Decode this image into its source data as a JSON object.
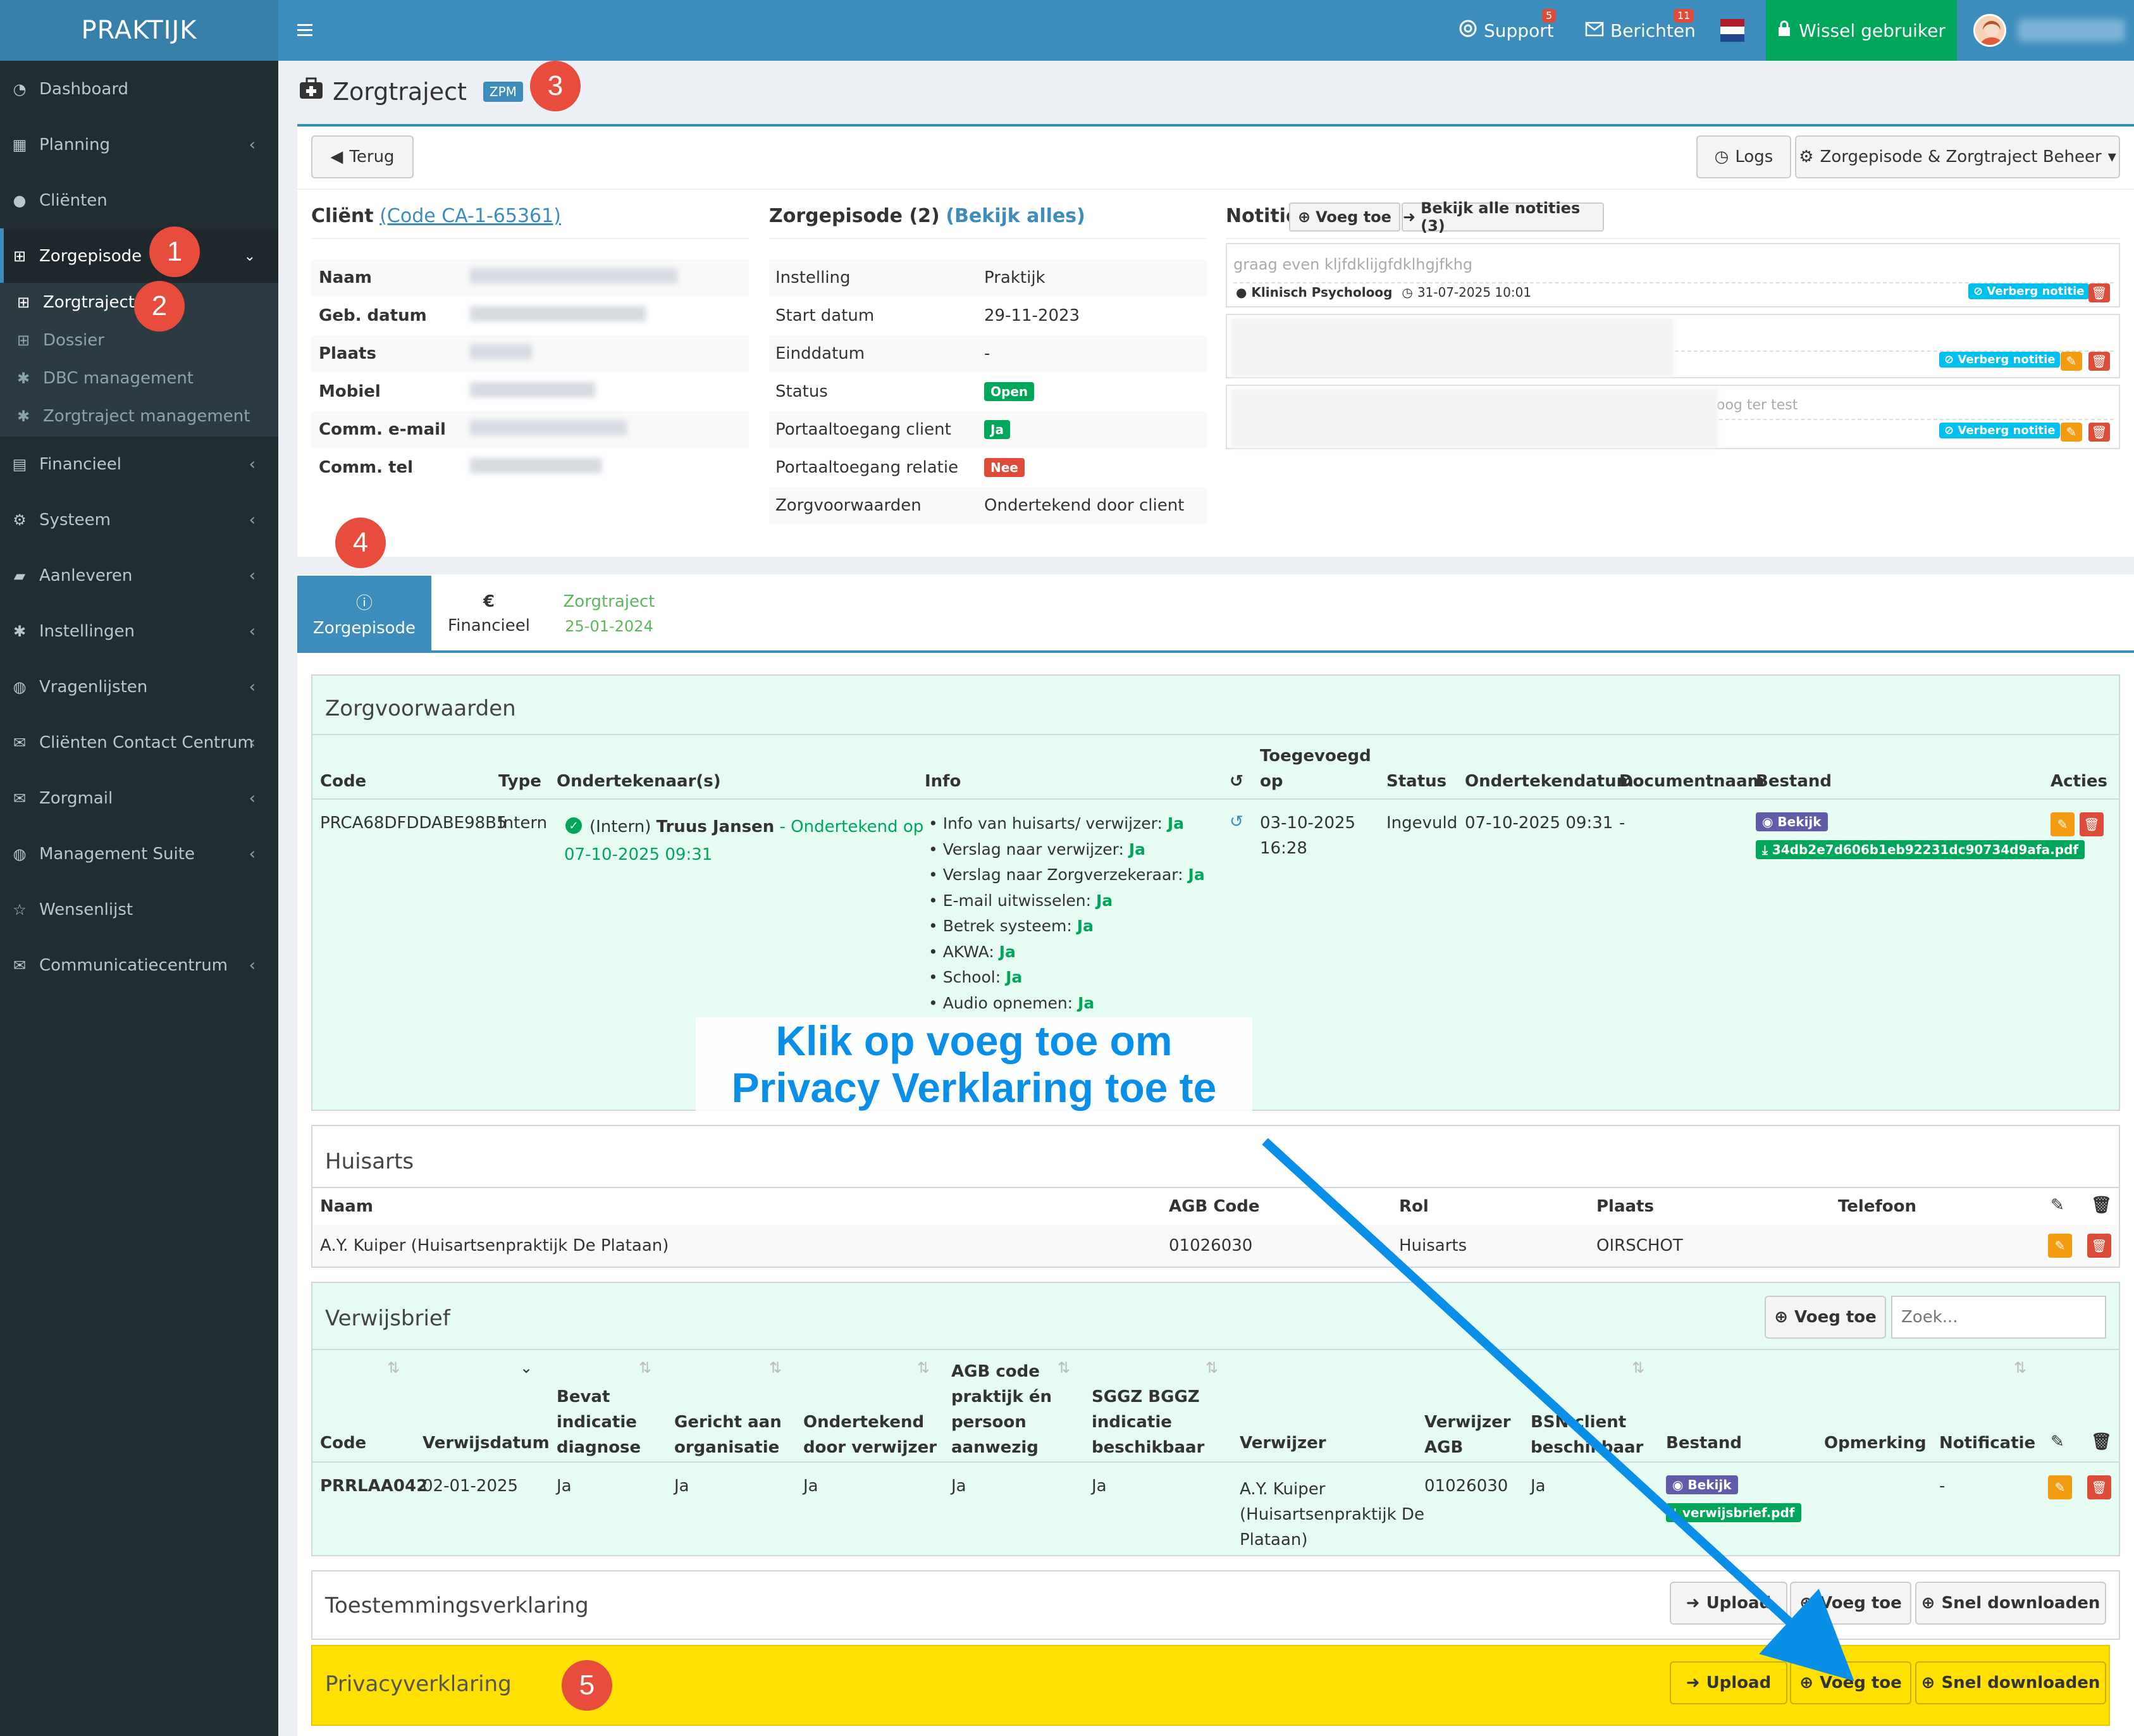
{
  "app": {
    "brand": "PRAKTIJK"
  },
  "topbar": {
    "support": "Support",
    "support_badge": "5",
    "messages": "Berichten",
    "messages_badge": "11",
    "switch_user": "Wissel gebruiker"
  },
  "sidebar": {
    "items": [
      {
        "label": "Dashboard",
        "icon": "dashboard-icon"
      },
      {
        "label": "Planning",
        "icon": "calendar-icon"
      },
      {
        "label": "Cliënten",
        "icon": "user-icon"
      },
      {
        "label": "Zorgepisode",
        "icon": "medkit-icon"
      },
      {
        "label": "Financieel",
        "icon": "book-icon"
      },
      {
        "label": "Systeem",
        "icon": "cogs-icon"
      },
      {
        "label": "Aanleveren",
        "icon": "truck-icon"
      },
      {
        "label": "Instellingen",
        "icon": "gear-icon"
      },
      {
        "label": "Vragenlijsten",
        "icon": "globe-icon"
      },
      {
        "label": "Cliënten Contact Centrum",
        "icon": "envelope-icon"
      },
      {
        "label": "Zorgmail",
        "icon": "envelope-icon"
      },
      {
        "label": "Management Suite",
        "icon": "globe-icon"
      },
      {
        "label": "Wensenlijst",
        "icon": "star-icon"
      },
      {
        "label": "Communicatiecentrum",
        "icon": "envelope-icon"
      }
    ],
    "subitems": [
      "Zorgtraject",
      "Dossier",
      "DBC management",
      "Zorgtraject management"
    ]
  },
  "markers": [
    "1",
    "2",
    "3",
    "4",
    "5"
  ],
  "page": {
    "title": "Zorgtraject",
    "badge": "ZPM"
  },
  "toolbar": {
    "back": "Terug",
    "logs": "Logs",
    "manage": "Zorgepisode & Zorgtraject Beheer"
  },
  "client": {
    "heading": "Cliënt",
    "code_link": "(Code CA-1-65361)",
    "rows": [
      "Naam",
      "Geb. datum",
      "Plaats",
      "Mobiel",
      "Comm. e-mail",
      "Comm. tel"
    ]
  },
  "episode": {
    "heading": "Zorgepisode (2)",
    "link": "(Bekijk alles)",
    "rows": [
      {
        "k": "Instelling",
        "v": "Praktijk"
      },
      {
        "k": "Start datum",
        "v": "29-11-2023"
      },
      {
        "k": "Einddatum",
        "v": "-"
      },
      {
        "k": "Status",
        "v": "Open"
      },
      {
        "k": "Portaaltoegang client",
        "v": "Ja"
      },
      {
        "k": "Portaaltoegang relatie",
        "v": "Nee"
      },
      {
        "k": "Zorgvoorwaarden",
        "v": "Ondertekend door client"
      }
    ]
  },
  "notes": {
    "heading": "Notitie",
    "add": "Voeg toe",
    "all": "Bekijk alle notities (3)",
    "note1_text": "graag even kljfdklijgfdklhgjfkhg",
    "note1_author": "Klinisch Psycholoog",
    "note1_date": "31-07-2025 10:01",
    "hide": "Verberg notitie",
    "note3_text": "oog ter test"
  },
  "tabs": [
    {
      "label": "Zorgepisode",
      "icon": "info-icon"
    },
    {
      "label": "Financieel",
      "icon": "euro-icon"
    },
    {
      "label": "Zorgtraject",
      "sub": "25-01-2024"
    }
  ],
  "zorgvoorwaarden": {
    "title": "Zorgvoorwaarden",
    "headers": [
      "Code",
      "Type",
      "Ondertekenaar(s)",
      "Info",
      "Toegevoegd",
      "op",
      "Status",
      "Ondertekendatum",
      "Documentnaam",
      "Bestand",
      "Acties"
    ],
    "row": {
      "code": "PRCA68DFDDABE98B5",
      "type": "Intern",
      "signer_prefix": "(Intern)",
      "signer_name": "Truus Jansen",
      "signer_suffix": "- Ondertekend op",
      "signer_date": "07-10-2025 09:31",
      "info": [
        {
          "k": "Info van huisarts/ verwijzer:",
          "v": "Ja"
        },
        {
          "k": "Verslag naar verwijzer:",
          "v": "Ja"
        },
        {
          "k": "Verslag naar Zorgverzekeraar:",
          "v": "Ja"
        },
        {
          "k": "E-mail uitwisselen:",
          "v": "Ja"
        },
        {
          "k": "Betrek systeem:",
          "v": "Ja"
        },
        {
          "k": "AKWA:",
          "v": "Ja"
        },
        {
          "k": "School:",
          "v": "Ja"
        },
        {
          "k": "Audio opnemen:",
          "v": "Ja"
        }
      ],
      "added_date": "03-10-2025",
      "added_time": "16:28",
      "status": "Ingevuld",
      "signed_date": "07-10-2025 09:31",
      "docname": "-",
      "view": "Bekijk",
      "file": "34db2e7d606b1eb92231dc90734d9afa.pdf"
    }
  },
  "annotation": "Klik op voeg toe om Privacy Verklaring toe te voegen",
  "huisarts": {
    "title": "Huisarts",
    "headers": [
      "Naam",
      "AGB Code",
      "Rol",
      "Plaats",
      "Telefoon"
    ],
    "row": {
      "name": "A.Y. Kuiper (Huisartsenpraktijk De Plataan)",
      "agb": "01026030",
      "rol": "Huisarts",
      "plaats": "OIRSCHOT",
      "tel": ""
    }
  },
  "verwijsbrief": {
    "title": "Verwijsbrief",
    "add": "Voeg toe",
    "search_placeholder": "Zoek...",
    "headers": {
      "code": "Code",
      "date": "Verwijsdatum",
      "indicatie": [
        "Bevat",
        "indicatie",
        "diagnose"
      ],
      "gericht": [
        "Gericht aan",
        "organisatie"
      ],
      "ondertekend": [
        "Ondertekend",
        "door verwijzer"
      ],
      "agb": [
        "AGB code",
        "praktijk én",
        "persoon",
        "aanwezig"
      ],
      "sggz": [
        "SGGZ BGGZ",
        "indicatie",
        "beschikbaar"
      ],
      "verwijzer": "Verwijzer",
      "vagb": [
        "Verwijzer",
        "AGB"
      ],
      "bsn": [
        "BSN client",
        "beschikbaar"
      ],
      "bestand": "Bestand",
      "opmerking": "Opmerking",
      "notificatie": "Notificatie"
    },
    "row": {
      "code": "PRRLAA042",
      "date": "02-01-2025",
      "indicatie": "Ja",
      "gericht": "Ja",
      "ondertekend": "Ja",
      "agb": "Ja",
      "sggz": "Ja",
      "verwijzer": [
        "A.Y. Kuiper",
        "(Huisartsenpraktijk De",
        "Plataan)"
      ],
      "vagb": "01026030",
      "bsn": "Ja",
      "view": "Bekijk",
      "file": "verwijsbrief.pdf",
      "notificatie": "-"
    }
  },
  "toestemming": {
    "title": "Toestemmingsverklaring",
    "upload": "Upload",
    "add": "Voeg toe",
    "download": "Snel downloaden"
  },
  "privacy": {
    "title": "Privacyverklaring",
    "upload": "Upload",
    "add": "Voeg toe",
    "download": "Snel downloaden"
  },
  "colors": {
    "primary": "#3c8dbc",
    "sidebar": "#222d32",
    "success": "#00a65a",
    "danger": "#dd4b39",
    "highlight": "#ffe000",
    "annotation": "#0a8fe8"
  }
}
